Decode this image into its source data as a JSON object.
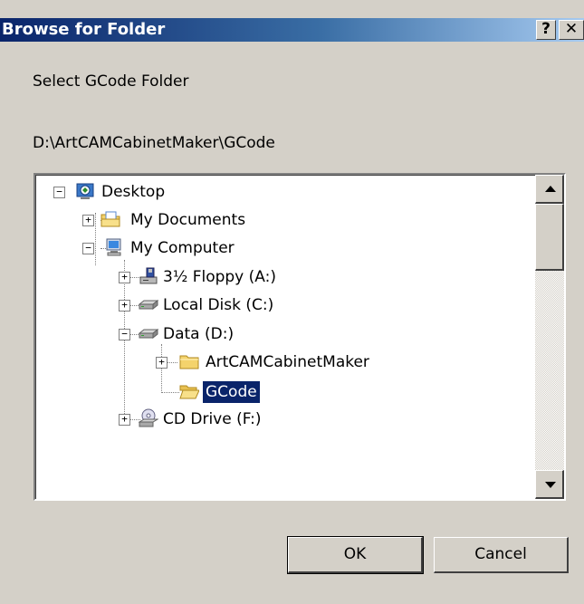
{
  "window": {
    "title": "Browse for Folder",
    "help_label": "?",
    "close_label": "✕"
  },
  "dialog": {
    "instruction": "Select GCode Folder",
    "current_path": "D:\\ArtCAMCabinetMaker\\GCode"
  },
  "tree": {
    "items": [
      {
        "label": "Desktop",
        "icon": "desktop-icon",
        "expander": "−",
        "selected": false
      },
      {
        "label": "My Documents",
        "icon": "documents-folder-icon",
        "expander": "+",
        "selected": false
      },
      {
        "label": "My Computer",
        "icon": "computer-icon",
        "expander": "−",
        "selected": false
      },
      {
        "label": "3½ Floppy (A:)",
        "icon": "floppy-drive-icon",
        "expander": "+",
        "selected": false
      },
      {
        "label": "Local Disk (C:)",
        "icon": "hard-disk-icon",
        "expander": "+",
        "selected": false
      },
      {
        "label": "Data (D:)",
        "icon": "hard-disk-icon",
        "expander": "−",
        "selected": false
      },
      {
        "label": "ArtCAMCabinetMaker",
        "icon": "folder-icon",
        "expander": "+",
        "selected": false
      },
      {
        "label": "GCode",
        "icon": "open-folder-icon",
        "expander": "",
        "selected": true
      },
      {
        "label": "CD Drive (F:)",
        "icon": "cd-drive-icon",
        "expander": "+",
        "selected": false
      }
    ]
  },
  "buttons": {
    "ok_label": "OK",
    "cancel_label": "Cancel"
  },
  "colors": {
    "title_bar": "#0a246a",
    "selection": "#0a246a",
    "dialog_bg": "#d4d0c8"
  }
}
